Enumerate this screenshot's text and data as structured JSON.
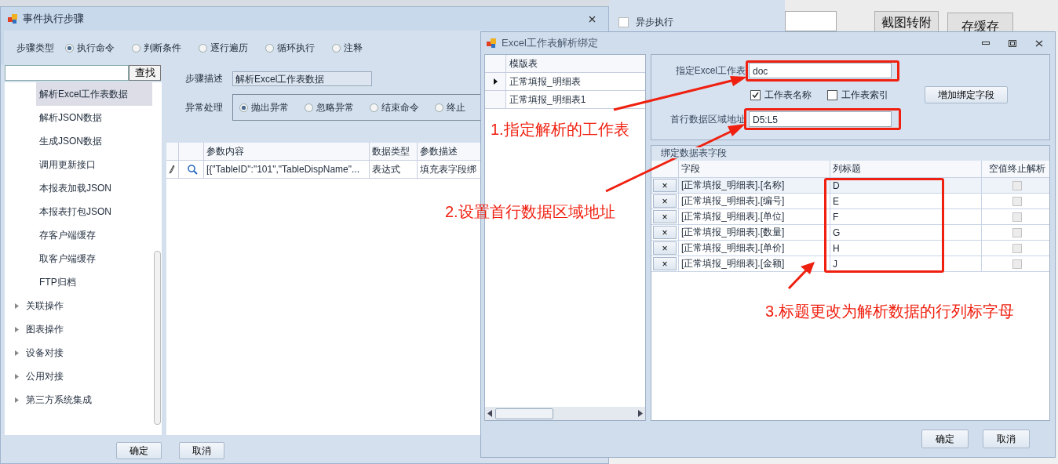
{
  "background": {
    "async_checkbox": {
      "label": "异步执行",
      "checked": false
    },
    "buttons": [
      "截图转附",
      "存缓存"
    ]
  },
  "steps_window": {
    "title": "事件执行步骤",
    "step_type": {
      "label": "步骤类型",
      "options": [
        {
          "label": "执行命令",
          "selected": true
        },
        {
          "label": "判断条件",
          "selected": false
        },
        {
          "label": "逐行遍历",
          "selected": false
        },
        {
          "label": "循环执行",
          "selected": false
        },
        {
          "label": "注释",
          "selected": false
        }
      ]
    },
    "search": {
      "button": "查找"
    },
    "tree": {
      "children": [
        {
          "label": "解析Excel工作表数据",
          "selected": true
        },
        {
          "label": "解析JSON数据",
          "selected": false
        },
        {
          "label": "生成JSON数据",
          "selected": false
        },
        {
          "label": "调用更新接口",
          "selected": false
        },
        {
          "label": "本报表加载JSON",
          "selected": false
        },
        {
          "label": "本报表打包JSON",
          "selected": false
        },
        {
          "label": "存客户端缓存",
          "selected": false
        },
        {
          "label": "取客户端缓存",
          "selected": false
        },
        {
          "label": "FTP归档",
          "selected": false
        }
      ],
      "groups": [
        {
          "label": "关联操作",
          "expanded": false
        },
        {
          "label": "图表操作",
          "expanded": false
        },
        {
          "label": "设备对接",
          "expanded": false
        },
        {
          "label": "公用对接",
          "expanded": false
        },
        {
          "label": "第三方系统集成",
          "expanded": false
        }
      ]
    },
    "description": {
      "label": "步骤描述",
      "value": "解析Excel工作表数据"
    },
    "exception": {
      "label": "异常处理",
      "options": [
        {
          "label": "抛出异常",
          "selected": true
        },
        {
          "label": "忽略异常",
          "selected": false
        },
        {
          "label": "结束命令",
          "selected": false
        },
        {
          "label": "终止",
          "selected": false
        }
      ]
    },
    "params_table": {
      "columns": [
        "参数内容",
        "数据类型",
        "参数描述"
      ],
      "rows": [
        {
          "content": "[{\"TableID\":\"101\",\"TableDispName\"...",
          "type": "表达式",
          "description": "填充表字段绑"
        }
      ]
    },
    "buttons": [
      "确定",
      "取消"
    ]
  },
  "excel_window": {
    "title": "Excel工作表解析绑定",
    "templates": {
      "column": "模版表",
      "rows": [
        {
          "name": "正常填报_明细表",
          "selected": true
        },
        {
          "name": "正常填报_明细表1",
          "selected": false
        }
      ]
    },
    "sheet": {
      "label": "指定Excel工作表",
      "value": "doc"
    },
    "sheet_name": {
      "label": "工作表名称",
      "checked": true
    },
    "sheet_index": {
      "label": "工作表索引",
      "checked": false
    },
    "add_button": "增加绑定字段",
    "range": {
      "label": "首行数据区域地址",
      "value": "D5:L5"
    },
    "bindings": {
      "title": "绑定数据表字段",
      "columns": [
        "字段",
        "列标题",
        "空值终止解析"
      ],
      "rows": [
        {
          "delete": "×",
          "field": "[正常填报_明细表].[名称]",
          "column_title": "D",
          "stop_on_empty": false
        },
        {
          "delete": "×",
          "field": "[正常填报_明细表].[编号]",
          "column_title": "E",
          "stop_on_empty": false
        },
        {
          "delete": "×",
          "field": "[正常填报_明细表].[单位]",
          "column_title": "F",
          "stop_on_empty": false
        },
        {
          "delete": "×",
          "field": "[正常填报_明细表].[数量]",
          "column_title": "G",
          "stop_on_empty": false
        },
        {
          "delete": "×",
          "field": "[正常填报_明细表].[单价]",
          "column_title": "H",
          "stop_on_empty": false
        },
        {
          "delete": "×",
          "field": "[正常填报_明细表].[金额]",
          "column_title": "J",
          "stop_on_empty": false
        }
      ]
    },
    "buttons": [
      "确定",
      "取消"
    ]
  },
  "annotations": [
    "1.指定解析的工作表",
    "2.设置首行数据区域地址",
    "3.标题更改为解析数据的行列标字母"
  ]
}
